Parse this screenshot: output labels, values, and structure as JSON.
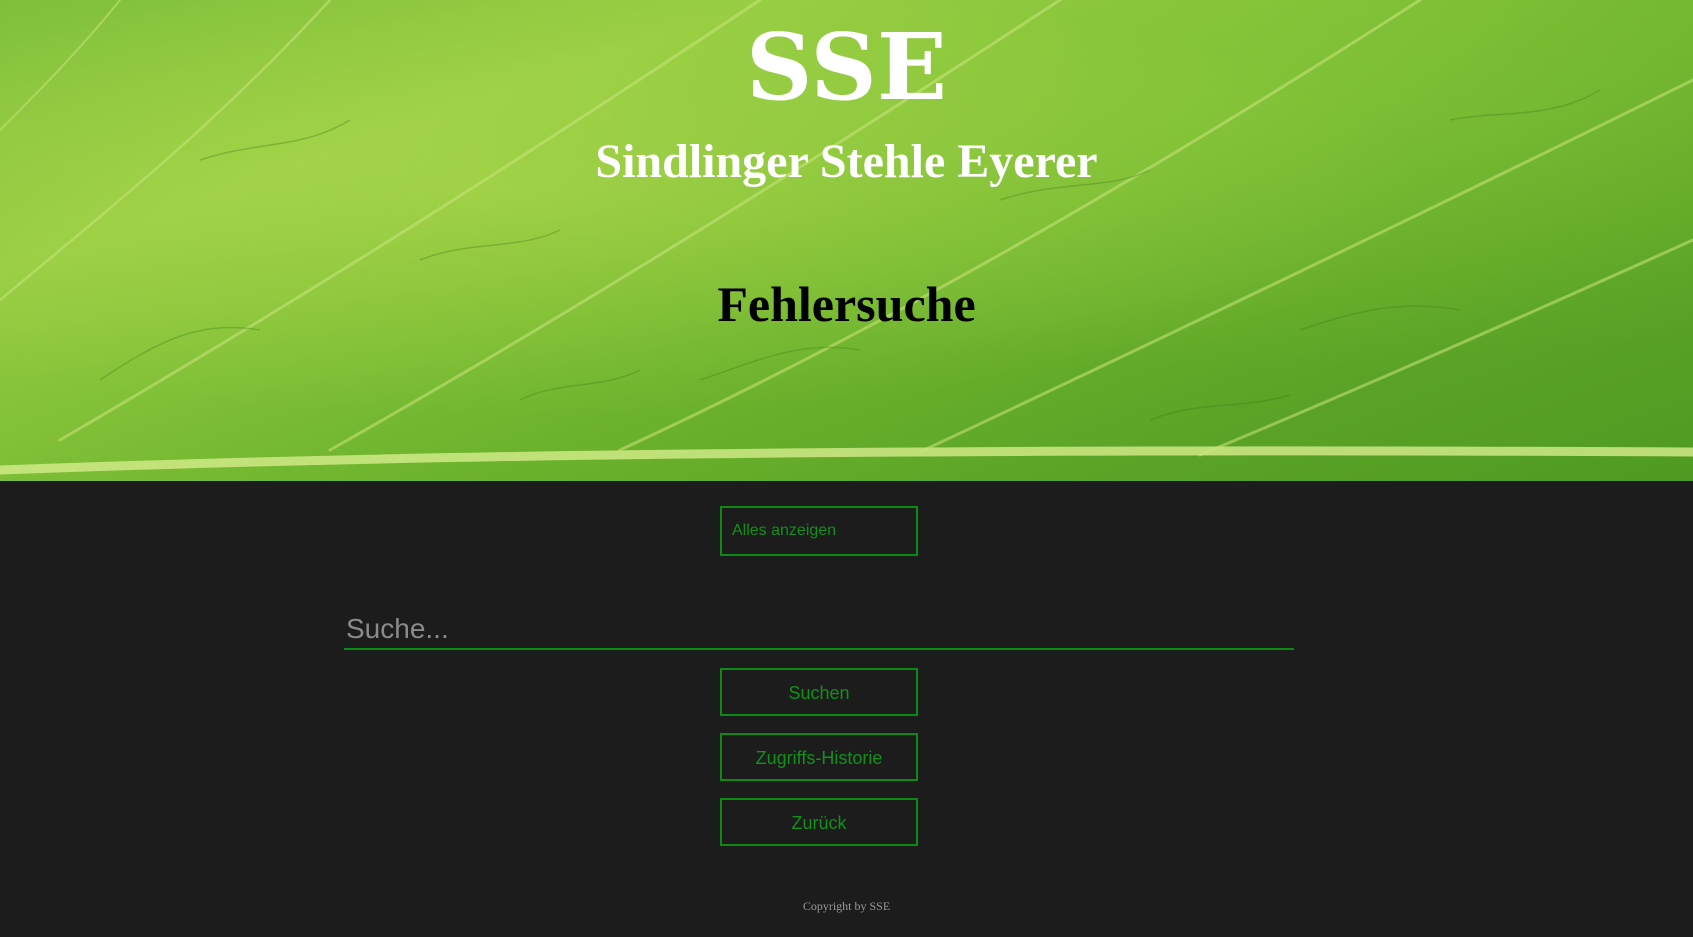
{
  "header": {
    "title": "SSE",
    "subtitle": "Sindlinger Stehle Eyerer",
    "page_heading": "Fehlersuche"
  },
  "actions": {
    "show_all_label": "Alles anzeigen"
  },
  "search": {
    "placeholder": "Suche...",
    "value": "",
    "submit_label": "Suchen"
  },
  "nav": {
    "history_label": "Zugriffs-Historie",
    "back_label": "Zurück"
  },
  "footer": {
    "copyright": "Copyright by SSE"
  },
  "colors": {
    "accent": "#0d8a14",
    "background": "#1c1c1c"
  }
}
